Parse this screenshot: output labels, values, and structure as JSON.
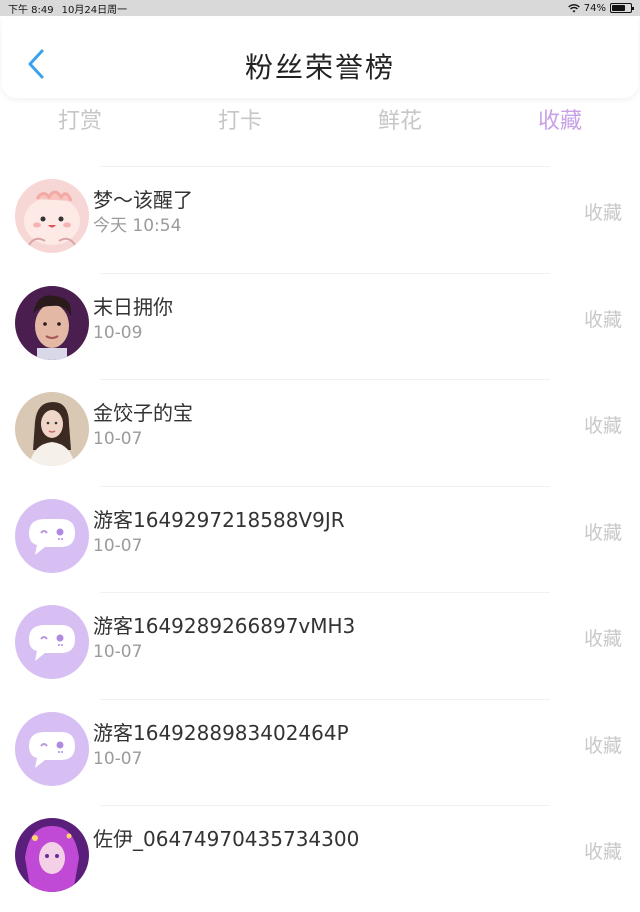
{
  "status_bar": {
    "time": "下午 8:49",
    "date": "10月24日周一",
    "battery": "74%",
    "battery_level": 0.74
  },
  "header": {
    "title": "粉丝荣誉榜",
    "back_icon": "chevron-left-icon",
    "accent": "#3aa0f0"
  },
  "tabs": [
    {
      "label": "打赏"
    },
    {
      "label": "打卡"
    },
    {
      "label": "鲜花"
    },
    {
      "label": "收藏",
      "active": true,
      "color": "#c9a1e8"
    }
  ],
  "fans": [
    {
      "name": "梦～该醒了",
      "time": "今天 10:54",
      "action": "收藏",
      "avatar": "pink-cartoon-avatar"
    },
    {
      "name": "末日拥你",
      "time": "10-09",
      "action": "收藏",
      "avatar": "man-portrait-avatar"
    },
    {
      "name": "金饺子的宝",
      "time": "10-07",
      "action": "收藏",
      "avatar": "girl-portrait-avatar"
    },
    {
      "name": "游客1649297218588V9JR",
      "time": "10-07",
      "action": "收藏",
      "avatar": "guest-chat-avatar"
    },
    {
      "name": "游客1649289266897vMH3",
      "time": "10-07",
      "action": "收藏",
      "avatar": "guest-chat-avatar"
    },
    {
      "name": "游客1649288983402464P",
      "time": "10-07",
      "action": "收藏",
      "avatar": "guest-chat-avatar"
    },
    {
      "name": "佐伊_06474970435734300",
      "time": "",
      "action": "收藏",
      "avatar": "anime-character-avatar"
    }
  ]
}
